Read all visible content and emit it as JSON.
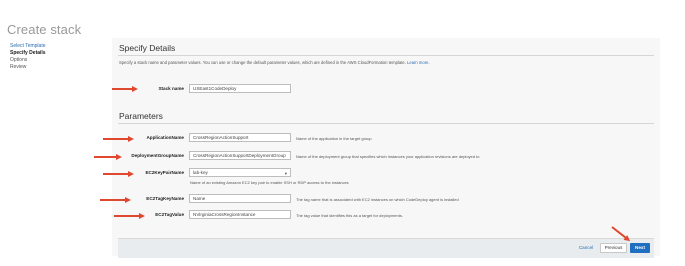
{
  "page": {
    "title": "Create stack"
  },
  "nav": {
    "items": [
      "Select Template",
      "Specify Details",
      "Options",
      "Review"
    ]
  },
  "details": {
    "title": "Specify Details",
    "description": "Specify a stack name and parameter values. You can use or change the default parameter values, which are defined in the AWS CloudFormation template.",
    "learn_more": "Learn more.",
    "stack_name_label": "Stack name",
    "stack_name_value": "USEast1CodeDeploy"
  },
  "parameters": {
    "title": "Parameters",
    "fields": [
      {
        "label": "ApplicationName",
        "value": "CrossRegionActionSupport",
        "hint": "Name of the application in the target group"
      },
      {
        "label": "DeploymentGroupName",
        "value": "CrossRegionActionSupportDeploymentGroup",
        "hint": "Name of the deployment group that specifies which instances your application revisions are deployed to"
      },
      {
        "label": "EC2KeyPairName",
        "value": "lab-key",
        "hint": "Name of an existing Amazon EC2 key pair to enable SSH or RDP access to the instances"
      },
      {
        "label": "EC2TagKeyName",
        "value": "Name",
        "hint": "The tag name that is associated with EC2 instances on which CodeDeploy agent is installed"
      },
      {
        "label": "EC2TagValue",
        "value": "NVirginiaCrossRegionInstance",
        "hint": "The tag value that identifies this as a target for deployments."
      }
    ]
  },
  "buttons": {
    "cancel": "Cancel",
    "previous": "Previous",
    "next": "Next"
  },
  "colors": {
    "accent": "#1f6ebf",
    "annotation_arrow": "#e0472f",
    "link": "#2b6cb0"
  },
  "icons": {
    "select_caret": "chevron-down-icon",
    "annotation": "arrow-right-icon"
  }
}
